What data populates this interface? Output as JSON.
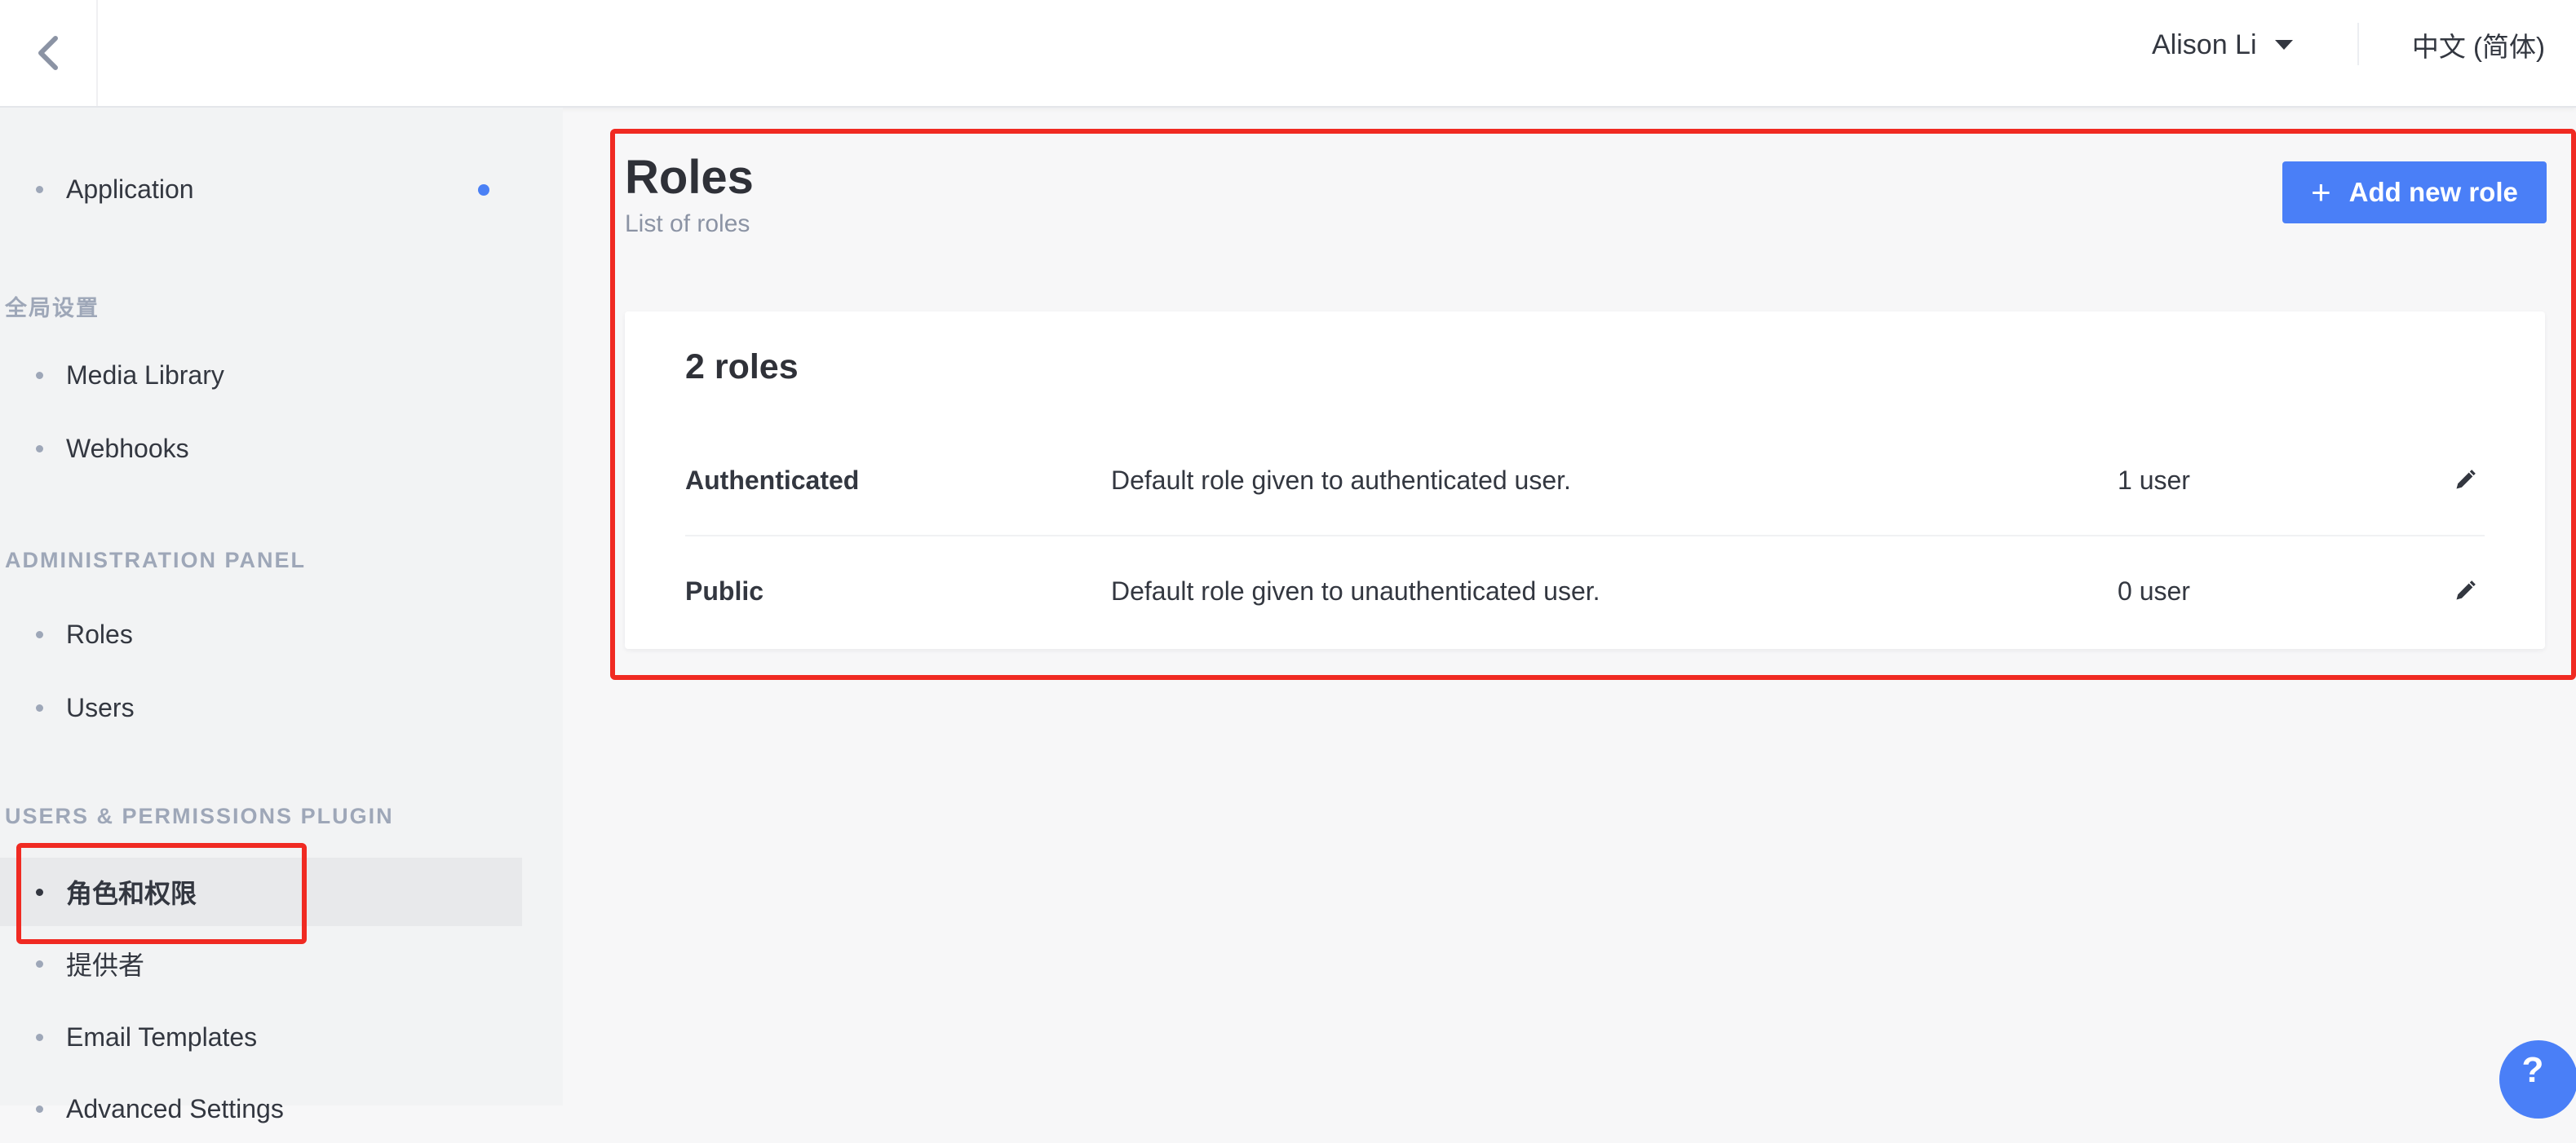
{
  "header": {
    "user_name": "Alison Li",
    "language": "中文 (简体)"
  },
  "sidebar": {
    "top_items": [
      {
        "label": "Application"
      }
    ],
    "sections": [
      {
        "title": "全局设置",
        "items": [
          {
            "label": "Media Library"
          },
          {
            "label": "Webhooks"
          }
        ]
      },
      {
        "title": "ADMINISTRATION PANEL",
        "items": [
          {
            "label": "Roles"
          },
          {
            "label": "Users"
          }
        ]
      },
      {
        "title": "USERS & PERMISSIONS PLUGIN",
        "items": [
          {
            "label": "角色和权限",
            "active": true
          },
          {
            "label": "提供者"
          },
          {
            "label": "Email Templates"
          },
          {
            "label": "Advanced Settings"
          }
        ]
      }
    ]
  },
  "main": {
    "title": "Roles",
    "subtitle": "List of roles",
    "add_button_label": "Add new role",
    "roles_count_label": "2 roles",
    "roles": [
      {
        "name": "Authenticated",
        "description": "Default role given to authenticated user.",
        "users": "1 user"
      },
      {
        "name": "Public",
        "description": "Default role given to unauthenticated user.",
        "users": "0 user"
      }
    ]
  },
  "help": {
    "label": "?"
  },
  "colors": {
    "accent": "#4a7ff7",
    "annotation": "#f02a22"
  },
  "icons": [
    "chevron-left-icon",
    "caret-down-icon",
    "plus-icon",
    "pencil-icon",
    "help-icon"
  ]
}
